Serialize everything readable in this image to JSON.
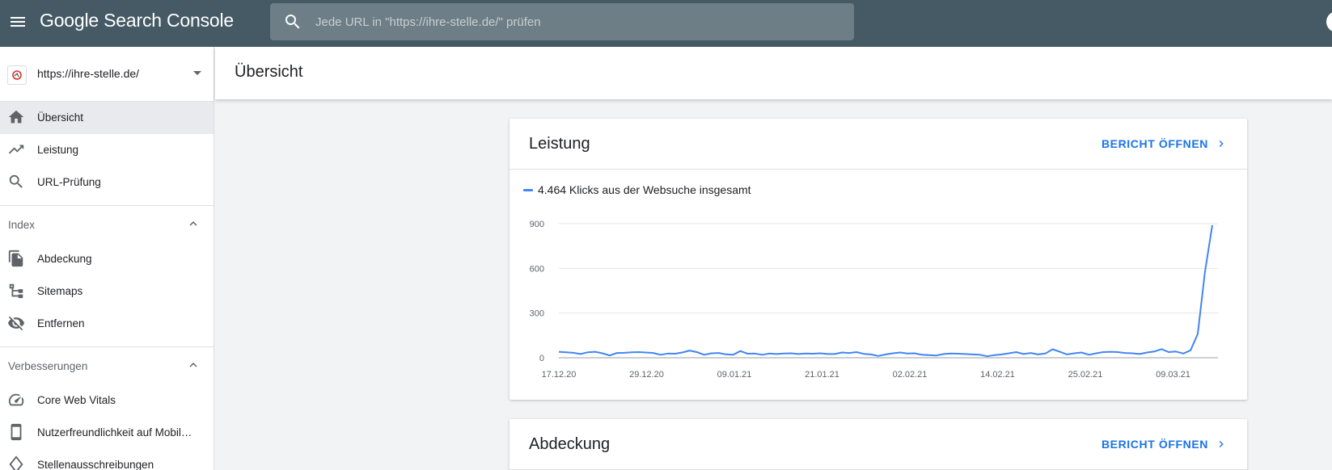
{
  "app": {
    "logo": "Google Search Console",
    "search_placeholder": "Jede URL in \"https://ihre-stelle.de/\" prüfen"
  },
  "sidebar": {
    "property_url": "https://ihre-stelle.de/",
    "items": [
      {
        "label": "Übersicht",
        "icon": "home-icon",
        "active": true
      },
      {
        "label": "Leistung",
        "icon": "trending-up-icon"
      },
      {
        "label": "URL-Prüfung",
        "icon": "search-icon"
      }
    ],
    "index": {
      "title": "Index",
      "items": [
        {
          "label": "Abdeckung",
          "icon": "copy-icon"
        },
        {
          "label": "Sitemaps",
          "icon": "sitemap-icon"
        },
        {
          "label": "Entfernen",
          "icon": "visibility-off-icon"
        }
      ]
    },
    "enhancements": {
      "title": "Verbesserungen",
      "items": [
        {
          "label": "Core Web Vitals",
          "icon": "speed-icon"
        },
        {
          "label": "Nutzerfreundlichkeit auf Mobil…",
          "icon": "smartphone-icon"
        },
        {
          "label": "Stellenausschreibungen",
          "icon": "diamond-icon"
        }
      ]
    }
  },
  "header": {
    "title": "Übersicht"
  },
  "performance_card": {
    "title": "Leistung",
    "link_label": "BERICHT ÖFFNEN",
    "legend": "4.464 Klicks aus der Websuche insgesamt"
  },
  "coverage_card": {
    "title": "Abdeckung",
    "link_label": "BERICHT ÖFFNEN"
  },
  "colors": {
    "topbar": "#455a64",
    "accent": "#1a73e8",
    "series": "#4285f4"
  },
  "chart_data": {
    "type": "line",
    "ylim": [
      0,
      900
    ],
    "yticks": [
      0,
      300,
      600,
      900
    ],
    "xtick_labels": [
      "17.12.20",
      "29.12.20",
      "09.01.21",
      "21.01.21",
      "02.02.21",
      "14.02.21",
      "25.02.21",
      "09.03.21"
    ],
    "grid": true,
    "series": [
      {
        "values": [
          40,
          37,
          33,
          25,
          37,
          40,
          30,
          15,
          32,
          33,
          37,
          38,
          35,
          32,
          20,
          28,
          27,
          35,
          48,
          38,
          20,
          30,
          32,
          23,
          20,
          45,
          27,
          28,
          20,
          28,
          25,
          28,
          30,
          25,
          28,
          27,
          30,
          25,
          25,
          35,
          32,
          38,
          26,
          22,
          12,
          22,
          30,
          35,
          28,
          30,
          20,
          18,
          15,
          25,
          28,
          27,
          25,
          22,
          20,
          10,
          18,
          22,
          30,
          38,
          25,
          32,
          22,
          28,
          57,
          40,
          22,
          30,
          35,
          20,
          30,
          38,
          40,
          38,
          32,
          30,
          25,
          35,
          42,
          58,
          38,
          42,
          28,
          50,
          160,
          580,
          890
        ]
      }
    ]
  }
}
